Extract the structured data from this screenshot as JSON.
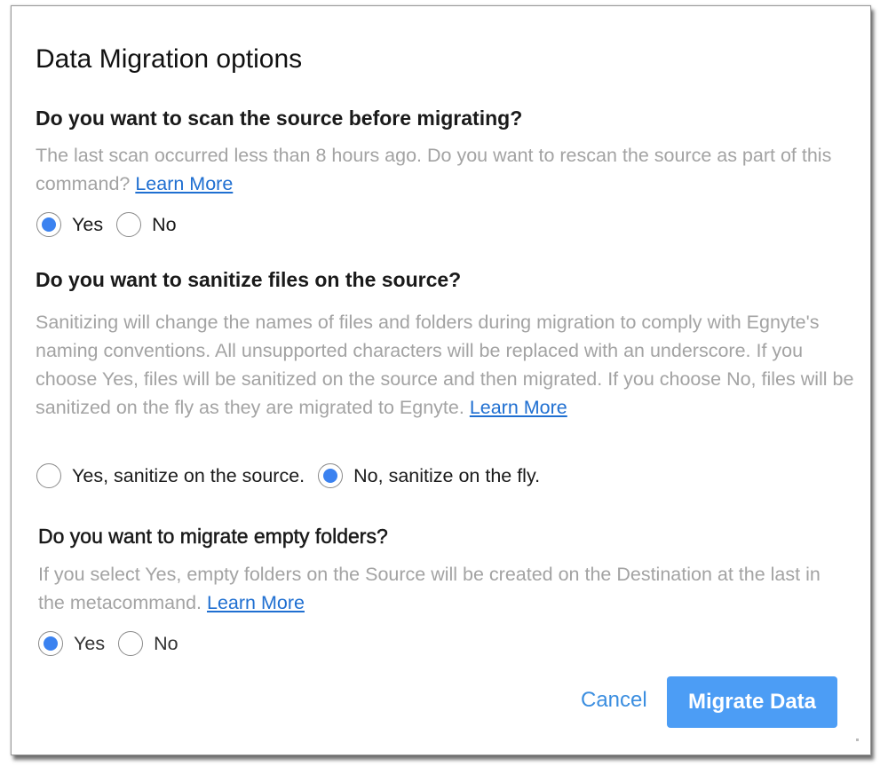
{
  "dialog": {
    "title": "Data Migration options"
  },
  "scan": {
    "heading": "Do you want to scan the source before migrating?",
    "description": "The last scan occurred less than 8 hours ago. Do you want to rescan the source as part of this command?",
    "link": "Learn More",
    "options": [
      {
        "label": "Yes",
        "selected": true
      },
      {
        "label": "No",
        "selected": false
      }
    ]
  },
  "sanitize": {
    "heading": "Do you want to sanitize files on the source?",
    "description": "Sanitizing will change the names of files and folders during migration to comply with Egnyte's naming conventions. All unsupported characters will be replaced with an underscore. If you choose Yes, files will be sanitized on the source and then migrated. If you choose No, files will be sanitized on the fly as they are migrated to Egnyte.",
    "link": "Learn More",
    "options": [
      {
        "label": "Yes, sanitize on the source.",
        "selected": false
      },
      {
        "label": "No, sanitize on the fly.",
        "selected": true
      }
    ]
  },
  "empty_folders": {
    "heading": "Do you want to migrate empty folders?",
    "description": "If you select Yes, empty folders on the Source will be created on the Destination at the last in the metacommand.",
    "link": "Learn More",
    "options": [
      {
        "label": "Yes",
        "selected": true
      },
      {
        "label": "No",
        "selected": false
      }
    ]
  },
  "actions": {
    "cancel_label": "Cancel",
    "primary_label": "Migrate Data"
  },
  "colors": {
    "accent": "#3b82f0",
    "primary_button": "#4c9df5",
    "link": "#1f6fd1",
    "muted_text": "#a3a3a3"
  }
}
